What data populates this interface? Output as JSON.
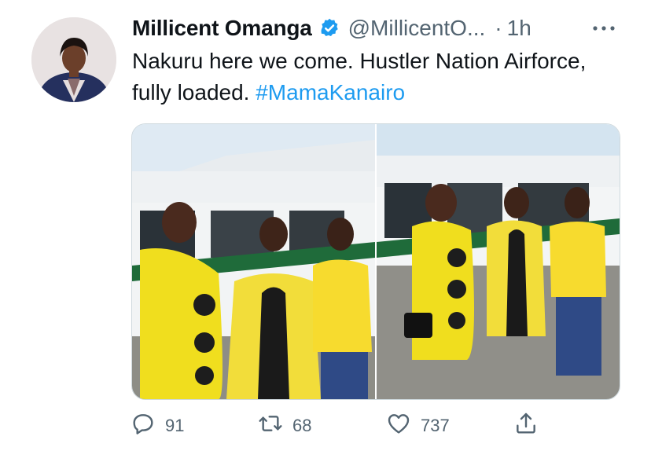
{
  "tweet": {
    "author_name": "Millicent Omanga",
    "handle": "@MillicentO...",
    "separator": "·",
    "time": "1h",
    "text": "Nakuru here we come. Hustler Nation Airforce, fully loaded.",
    "hashtag": "#MamaKanairo"
  },
  "icons": {
    "verified": "verified-badge-icon",
    "more": "more-icon",
    "reply": "reply-icon",
    "retweet": "retweet-icon",
    "like": "like-icon",
    "share": "share-icon"
  },
  "stats": {
    "replies": "91",
    "retweets": "68",
    "likes": "737"
  },
  "colors": {
    "link": "#1d9bf0",
    "secondary_text": "#536471",
    "verified": "#1d9bf0"
  }
}
